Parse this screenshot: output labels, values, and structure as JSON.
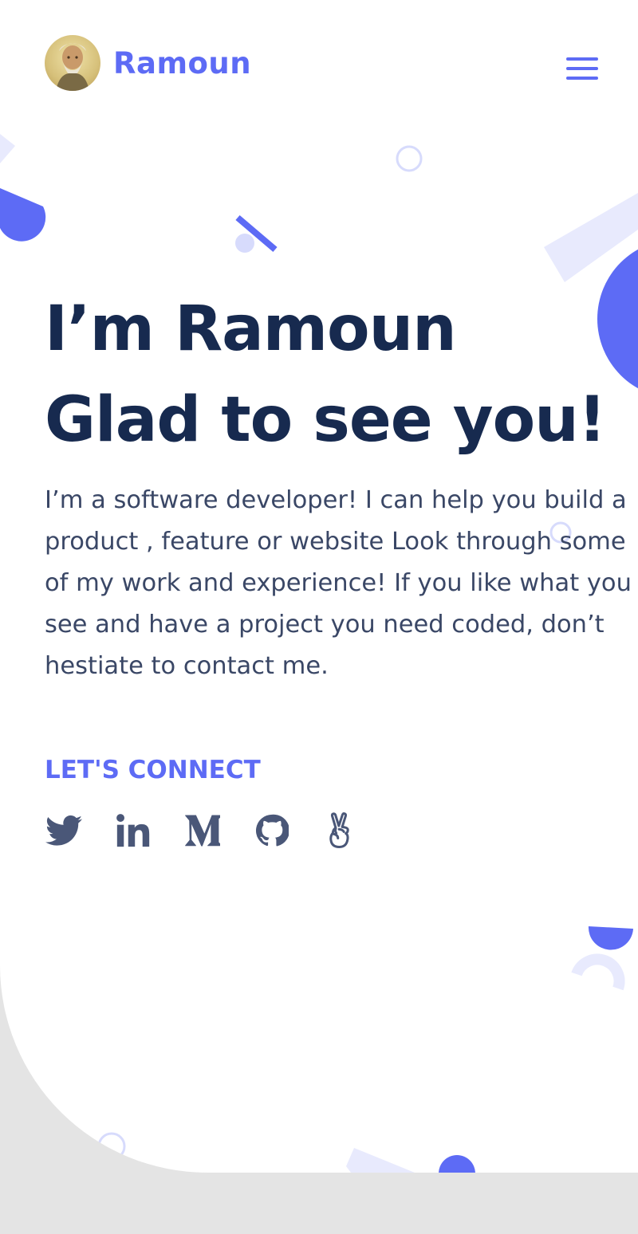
{
  "header": {
    "brand_name": "Ramoun",
    "avatar_icon": "bearded-man-portrait-icon",
    "menu_icon": "hamburger-menu-icon"
  },
  "hero": {
    "title_line1": "I’m Ramoun",
    "title_line2": "Glad to see you!",
    "intro": "I’m a software developer! I can help you build a product , feature or website Look through some of my work and experience! If you like what you see and have a project you need coded, don’t hestiate to contact me."
  },
  "connect": {
    "heading": "LET'S CONNECT",
    "socials": [
      {
        "icon": "twitter-icon"
      },
      {
        "icon": "linkedin-icon"
      },
      {
        "icon": "medium-icon"
      },
      {
        "icon": "github-icon"
      },
      {
        "icon": "angellist-icon"
      }
    ]
  },
  "colors": {
    "accent": "#5d6bf5",
    "accent_light": "#e8eafd",
    "heading": "#172a4f",
    "body_text": "#3a4766",
    "icon": "#4a5778",
    "footer_bg": "#e4e4e4"
  }
}
